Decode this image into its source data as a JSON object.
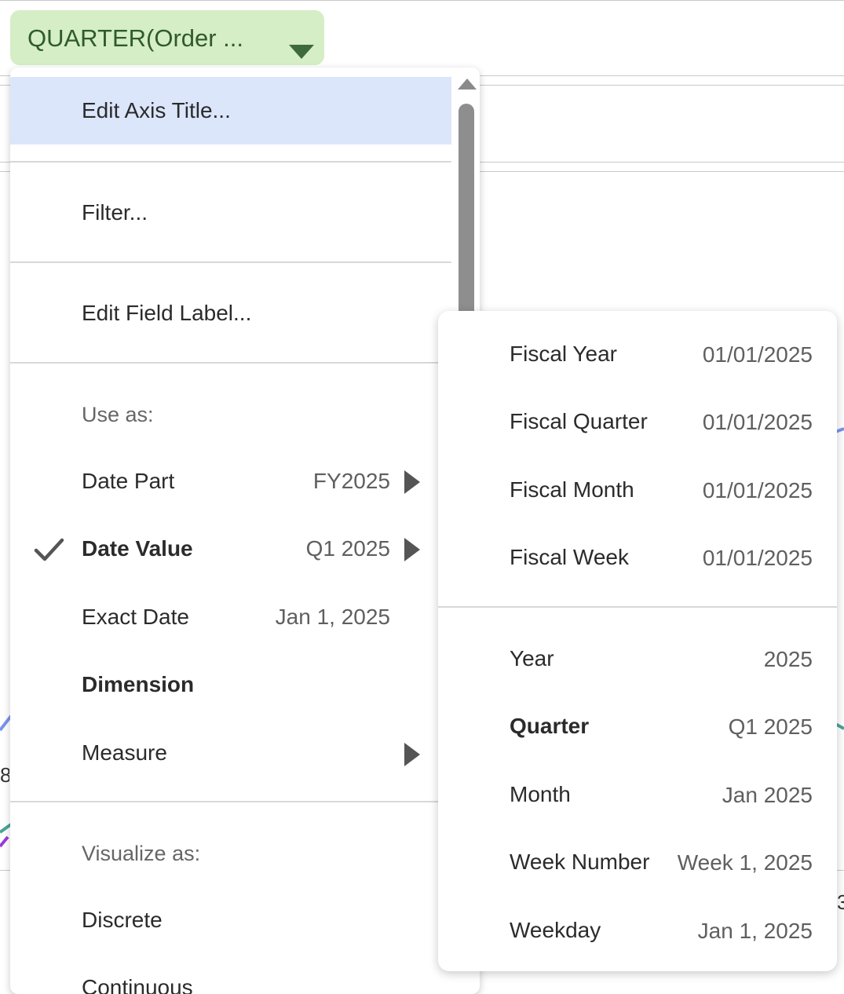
{
  "pill": {
    "label": "QUARTER(Order ...",
    "caret_icon": "caret-down-icon"
  },
  "menu": {
    "items": [
      {
        "label": "Edit Axis Title..."
      },
      {
        "label": "Filter..."
      },
      {
        "label": "Edit Field Label..."
      }
    ],
    "use_as": {
      "header": "Use as:",
      "items": [
        {
          "label": "Date Part",
          "value": "FY2025",
          "submenu": true,
          "checked": false
        },
        {
          "label": "Date Value",
          "value": "Q1 2025",
          "submenu": true,
          "checked": true
        },
        {
          "label": "Exact Date",
          "value": "Jan 1, 2025",
          "submenu": false,
          "checked": false
        },
        {
          "label": "Dimension",
          "value": "",
          "submenu": false,
          "checked": false
        },
        {
          "label": "Measure",
          "value": "",
          "submenu": true,
          "checked": false
        }
      ]
    },
    "visualize_as": {
      "header": "Visualize as:",
      "items": [
        {
          "label": "Discrete"
        },
        {
          "label": "Continuous"
        }
      ]
    }
  },
  "submenu": {
    "fiscal": [
      {
        "label": "Fiscal Year",
        "value": "01/01/2025"
      },
      {
        "label": "Fiscal Quarter",
        "value": "01/01/2025"
      },
      {
        "label": "Fiscal Month",
        "value": "01/01/2025"
      },
      {
        "label": "Fiscal Week",
        "value": "01/01/2025"
      }
    ],
    "calendar": [
      {
        "label": "Year",
        "value": "2025",
        "selected": false
      },
      {
        "label": "Quarter",
        "value": "Q1 2025",
        "selected": true
      },
      {
        "label": "Month",
        "value": "Jan 2025",
        "selected": false
      },
      {
        "label": "Week Number",
        "value": "Week 1, 2025",
        "selected": false
      },
      {
        "label": "Weekday",
        "value": "Jan 1, 2025",
        "selected": false
      }
    ]
  },
  "colors": {
    "pill_bg": "#d5eec6",
    "highlight_bg": "#dbe6fb",
    "series_blue": "#7b93ee",
    "series_teal": "#4aa39a",
    "series_purple": "#9b3bd9"
  }
}
